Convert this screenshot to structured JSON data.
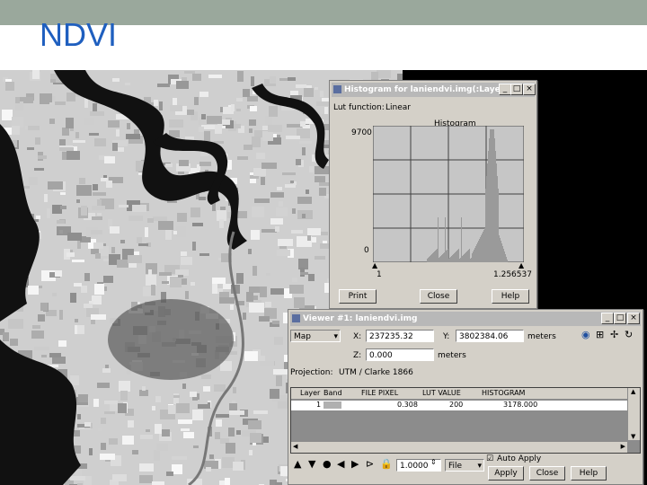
{
  "slide": {
    "title": "NDVI"
  },
  "histogram_window": {
    "title": "Histogram for laniendvi.img(:Layer...",
    "lut_function_label": "Lut function:",
    "lut_function_value": "Linear",
    "chart_title": "Histogram",
    "y_max_label": "9700",
    "y_min_label": "0",
    "x_min_label": "1",
    "x_max_label": "1.256537",
    "buttons": {
      "print": "Print",
      "close": "Close",
      "help": "Help"
    }
  },
  "viewer_window": {
    "title": "Viewer #1: laniendvi.img",
    "map_select": "Map",
    "x_label": "X:",
    "x_value": "237235.32",
    "y_label": "Y:",
    "y_value": "3802384.06",
    "units_select": "meters",
    "z_label": "Z:",
    "z_value": "0.000",
    "z_units": "meters",
    "projection_label": "Projection:",
    "projection_value": "UTM / Clarke 1866",
    "table": {
      "headers": [
        "Layer",
        "Band",
        "FILE PIXEL",
        "LUT VALUE",
        "HISTOGRAM"
      ],
      "row": {
        "layer": "1",
        "file_pixel": "0.308",
        "lut_value": "200",
        "histogram": "3178.000"
      }
    },
    "zoom_value": "1.0000",
    "file_select": "File",
    "auto_apply": "Auto Apply",
    "buttons": {
      "apply": "Apply",
      "close": "Close",
      "help": "Help"
    }
  }
}
